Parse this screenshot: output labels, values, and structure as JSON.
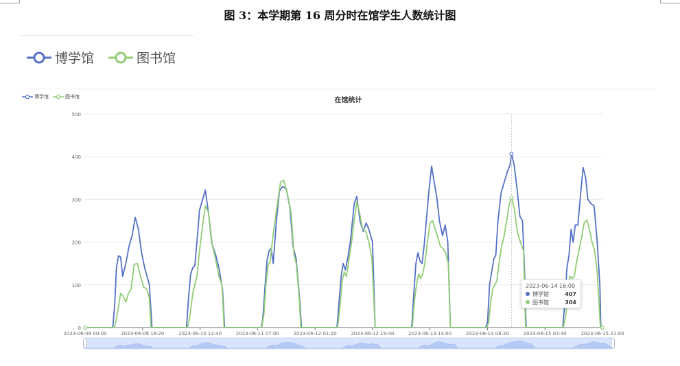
{
  "figure_title": "图 3：本学期第 16 周分时在馆学生人数统计图",
  "legend_big": [
    {
      "label": "博学馆",
      "color": "#5470c6"
    },
    {
      "label": "图书馆",
      "color": "#91cc75"
    }
  ],
  "chart_data": {
    "type": "line",
    "title": "在馆统计",
    "xlabel": "",
    "ylabel": "",
    "ylim": [
      0,
      500
    ],
    "yticks": [
      0,
      100,
      200,
      300,
      400,
      500
    ],
    "xlim": [
      "2023-06-09 00:00",
      "2023-06-15 21:00"
    ],
    "xticks": [
      "2023-06-09 00:00",
      "2023-06-09 18:20",
      "2023-06-10 12:40",
      "2023-06-11 07:00",
      "2023-06-12 01:20",
      "2023-06-12 19:40",
      "2023-06-13 14:00",
      "2023-06-14 08:20",
      "2023-06-15 02:40",
      "2023-06-15 21:00"
    ],
    "grid": true,
    "legend_position": "top-left",
    "series": [
      {
        "name": "博学馆",
        "color": "#5470c6",
        "points": [
          [
            "2023-06-09 00:00",
            0
          ],
          [
            "2023-06-09 08:50",
            0
          ],
          [
            "2023-06-09 09:30",
            60
          ],
          [
            "2023-06-09 10:00",
            140
          ],
          [
            "2023-06-09 10:40",
            168
          ],
          [
            "2023-06-09 11:20",
            165
          ],
          [
            "2023-06-09 12:00",
            120
          ],
          [
            "2023-06-09 13:00",
            150
          ],
          [
            "2023-06-09 14:00",
            190
          ],
          [
            "2023-06-09 15:00",
            215
          ],
          [
            "2023-06-09 16:00",
            258
          ],
          [
            "2023-06-09 17:00",
            230
          ],
          [
            "2023-06-09 18:00",
            175
          ],
          [
            "2023-06-09 19:00",
            140
          ],
          [
            "2023-06-09 20:30",
            100
          ],
          [
            "2023-06-09 21:20",
            0
          ],
          [
            "2023-06-10 08:20",
            0
          ],
          [
            "2023-06-10 09:00",
            70
          ],
          [
            "2023-06-10 09:40",
            125
          ],
          [
            "2023-06-10 10:20",
            140
          ],
          [
            "2023-06-10 11:00",
            145
          ],
          [
            "2023-06-10 11:40",
            200
          ],
          [
            "2023-06-10 12:30",
            275
          ],
          [
            "2023-06-10 13:30",
            300
          ],
          [
            "2023-06-10 14:20",
            322
          ],
          [
            "2023-06-10 15:20",
            270
          ],
          [
            "2023-06-10 16:30",
            195
          ],
          [
            "2023-06-10 17:40",
            170
          ],
          [
            "2023-06-10 18:40",
            140
          ],
          [
            "2023-06-10 19:50",
            90
          ],
          [
            "2023-06-10 20:30",
            0
          ],
          [
            "2023-06-11 08:10",
            0
          ],
          [
            "2023-06-11 08:40",
            20
          ],
          [
            "2023-06-11 09:20",
            90
          ],
          [
            "2023-06-11 10:00",
            155
          ],
          [
            "2023-06-11 10:40",
            180
          ],
          [
            "2023-06-11 11:20",
            185
          ],
          [
            "2023-06-11 12:00",
            150
          ],
          [
            "2023-06-11 13:00",
            250
          ],
          [
            "2023-06-11 14:00",
            320
          ],
          [
            "2023-06-11 15:00",
            330
          ],
          [
            "2023-06-11 16:10",
            325
          ],
          [
            "2023-06-11 17:20",
            280
          ],
          [
            "2023-06-11 18:20",
            190
          ],
          [
            "2023-06-11 19:20",
            160
          ],
          [
            "2023-06-11 20:30",
            60
          ],
          [
            "2023-06-11 21:00",
            0
          ],
          [
            "2023-06-12 08:20",
            0
          ],
          [
            "2023-06-12 09:00",
            60
          ],
          [
            "2023-06-12 09:40",
            120
          ],
          [
            "2023-06-12 10:20",
            150
          ],
          [
            "2023-06-12 11:00",
            135
          ],
          [
            "2023-06-12 11:50",
            165
          ],
          [
            "2023-06-12 12:40",
            205
          ],
          [
            "2023-06-12 13:50",
            290
          ],
          [
            "2023-06-12 14:40",
            307
          ],
          [
            "2023-06-12 15:40",
            250
          ],
          [
            "2023-06-12 16:40",
            225
          ],
          [
            "2023-06-12 17:40",
            245
          ],
          [
            "2023-06-12 18:30",
            230
          ],
          [
            "2023-06-12 19:40",
            200
          ],
          [
            "2023-06-12 20:30",
            0
          ],
          [
            "2023-06-13 08:10",
            0
          ],
          [
            "2023-06-13 08:50",
            80
          ],
          [
            "2023-06-13 09:30",
            150
          ],
          [
            "2023-06-13 10:10",
            175
          ],
          [
            "2023-06-13 10:50",
            155
          ],
          [
            "2023-06-13 11:30",
            150
          ],
          [
            "2023-06-13 12:10",
            195
          ],
          [
            "2023-06-13 12:50",
            250
          ],
          [
            "2023-06-13 13:40",
            320
          ],
          [
            "2023-06-13 14:30",
            378
          ],
          [
            "2023-06-13 15:20",
            340
          ],
          [
            "2023-06-13 16:10",
            305
          ],
          [
            "2023-06-13 17:00",
            250
          ],
          [
            "2023-06-13 18:00",
            215
          ],
          [
            "2023-06-13 18:50",
            240
          ],
          [
            "2023-06-13 19:40",
            200
          ],
          [
            "2023-06-13 20:30",
            0
          ],
          [
            "2023-06-14 07:40",
            0
          ],
          [
            "2023-06-14 08:20",
            10
          ],
          [
            "2023-06-14 09:00",
            100
          ],
          [
            "2023-06-14 09:40",
            130
          ],
          [
            "2023-06-14 10:20",
            160
          ],
          [
            "2023-06-14 11:00",
            170
          ],
          [
            "2023-06-14 11:40",
            250
          ],
          [
            "2023-06-14 12:40",
            315
          ],
          [
            "2023-06-14 13:40",
            340
          ],
          [
            "2023-06-14 14:40",
            365
          ],
          [
            "2023-06-14 15:30",
            380
          ],
          [
            "2023-06-14 16:00",
            407
          ],
          [
            "2023-06-14 16:50",
            380
          ],
          [
            "2023-06-14 17:50",
            320
          ],
          [
            "2023-06-14 18:40",
            260
          ],
          [
            "2023-06-14 19:30",
            250
          ],
          [
            "2023-06-14 20:10",
            130
          ],
          [
            "2023-06-14 20:40",
            0
          ],
          [
            "2023-06-15 08:20",
            0
          ],
          [
            "2023-06-15 09:00",
            60
          ],
          [
            "2023-06-15 09:40",
            140
          ],
          [
            "2023-06-15 10:20",
            170
          ],
          [
            "2023-06-15 11:00",
            230
          ],
          [
            "2023-06-15 11:40",
            200
          ],
          [
            "2023-06-15 12:20",
            240
          ],
          [
            "2023-06-15 13:10",
            240
          ],
          [
            "2023-06-15 14:00",
            310
          ],
          [
            "2023-06-15 14:50",
            375
          ],
          [
            "2023-06-15 15:40",
            350
          ],
          [
            "2023-06-15 16:20",
            300
          ],
          [
            "2023-06-15 17:20",
            290
          ],
          [
            "2023-06-15 18:20",
            285
          ],
          [
            "2023-06-15 19:20",
            200
          ],
          [
            "2023-06-15 20:10",
            100
          ],
          [
            "2023-06-15 20:30",
            0
          ],
          [
            "2023-06-15 21:00",
            0
          ]
        ]
      },
      {
        "name": "图书馆",
        "color": "#91cc75",
        "points": [
          [
            "2023-06-09 00:00",
            0
          ],
          [
            "2023-06-09 09:20",
            0
          ],
          [
            "2023-06-09 10:00",
            20
          ],
          [
            "2023-06-09 10:40",
            50
          ],
          [
            "2023-06-09 11:20",
            80
          ],
          [
            "2023-06-09 12:00",
            75
          ],
          [
            "2023-06-09 13:00",
            60
          ],
          [
            "2023-06-09 13:50",
            80
          ],
          [
            "2023-06-09 14:40",
            90
          ],
          [
            "2023-06-09 15:40",
            148
          ],
          [
            "2023-06-09 16:40",
            150
          ],
          [
            "2023-06-09 17:40",
            120
          ],
          [
            "2023-06-09 18:40",
            95
          ],
          [
            "2023-06-09 19:40",
            90
          ],
          [
            "2023-06-09 20:30",
            70
          ],
          [
            "2023-06-09 21:00",
            0
          ],
          [
            "2023-06-10 08:40",
            0
          ],
          [
            "2023-06-10 09:30",
            30
          ],
          [
            "2023-06-10 10:20",
            80
          ],
          [
            "2023-06-10 11:00",
            100
          ],
          [
            "2023-06-10 11:40",
            120
          ],
          [
            "2023-06-10 12:30",
            180
          ],
          [
            "2023-06-10 13:30",
            240
          ],
          [
            "2023-06-10 14:20",
            285
          ],
          [
            "2023-06-10 15:20",
            270
          ],
          [
            "2023-06-10 16:20",
            200
          ],
          [
            "2023-06-10 17:20",
            170
          ],
          [
            "2023-06-10 18:40",
            120
          ],
          [
            "2023-06-10 19:40",
            100
          ],
          [
            "2023-06-10 20:20",
            0
          ],
          [
            "2023-06-11 08:20",
            0
          ],
          [
            "2023-06-11 09:00",
            30
          ],
          [
            "2023-06-11 09:40",
            100
          ],
          [
            "2023-06-11 10:20",
            145
          ],
          [
            "2023-06-11 11:00",
            155
          ],
          [
            "2023-06-11 12:00",
            220
          ],
          [
            "2023-06-11 13:20",
            290
          ],
          [
            "2023-06-11 14:20",
            340
          ],
          [
            "2023-06-11 15:20",
            345
          ],
          [
            "2023-06-11 16:20",
            320
          ],
          [
            "2023-06-11 17:40",
            270
          ],
          [
            "2023-06-11 18:40",
            170
          ],
          [
            "2023-06-11 19:20",
            150
          ],
          [
            "2023-06-11 20:10",
            80
          ],
          [
            "2023-06-11 20:50",
            0
          ],
          [
            "2023-06-12 08:30",
            0
          ],
          [
            "2023-06-12 09:10",
            40
          ],
          [
            "2023-06-12 10:00",
            110
          ],
          [
            "2023-06-12 10:40",
            130
          ],
          [
            "2023-06-12 11:20",
            120
          ],
          [
            "2023-06-12 12:10",
            160
          ],
          [
            "2023-06-12 13:00",
            200
          ],
          [
            "2023-06-12 13:50",
            250
          ],
          [
            "2023-06-12 14:40",
            295
          ],
          [
            "2023-06-12 15:30",
            270
          ],
          [
            "2023-06-12 16:30",
            230
          ],
          [
            "2023-06-12 17:30",
            225
          ],
          [
            "2023-06-12 18:30",
            200
          ],
          [
            "2023-06-12 19:30",
            160
          ],
          [
            "2023-06-12 20:30",
            0
          ],
          [
            "2023-06-13 08:20",
            0
          ],
          [
            "2023-06-13 09:00",
            60
          ],
          [
            "2023-06-13 09:40",
            100
          ],
          [
            "2023-06-13 10:20",
            125
          ],
          [
            "2023-06-13 11:00",
            115
          ],
          [
            "2023-06-13 11:40",
            125
          ],
          [
            "2023-06-13 12:20",
            150
          ],
          [
            "2023-06-13 13:10",
            200
          ],
          [
            "2023-06-13 14:00",
            245
          ],
          [
            "2023-06-13 14:50",
            250
          ],
          [
            "2023-06-13 15:40",
            230
          ],
          [
            "2023-06-13 16:30",
            210
          ],
          [
            "2023-06-13 17:20",
            190
          ],
          [
            "2023-06-13 18:10",
            185
          ],
          [
            "2023-06-13 19:00",
            175
          ],
          [
            "2023-06-13 19:50",
            150
          ],
          [
            "2023-06-13 20:30",
            0
          ],
          [
            "2023-06-14 08:00",
            0
          ],
          [
            "2023-06-14 08:40",
            10
          ],
          [
            "2023-06-14 09:20",
            60
          ],
          [
            "2023-06-14 10:00",
            90
          ],
          [
            "2023-06-14 10:40",
            100
          ],
          [
            "2023-06-14 11:20",
            110
          ],
          [
            "2023-06-14 12:00",
            150
          ],
          [
            "2023-06-14 12:50",
            190
          ],
          [
            "2023-06-14 13:40",
            215
          ],
          [
            "2023-06-14 14:40",
            260
          ],
          [
            "2023-06-14 15:20",
            290
          ],
          [
            "2023-06-14 16:00",
            304
          ],
          [
            "2023-06-14 16:50",
            280
          ],
          [
            "2023-06-14 17:50",
            225
          ],
          [
            "2023-06-14 18:50",
            200
          ],
          [
            "2023-06-14 19:50",
            180
          ],
          [
            "2023-06-14 20:30",
            0
          ],
          [
            "2023-06-15 08:30",
            0
          ],
          [
            "2023-06-15 09:20",
            30
          ],
          [
            "2023-06-15 10:00",
            90
          ],
          [
            "2023-06-15 10:40",
            120
          ],
          [
            "2023-06-15 11:20",
            115
          ],
          [
            "2023-06-15 12:00",
            120
          ],
          [
            "2023-06-15 12:40",
            150
          ],
          [
            "2023-06-15 13:30",
            180
          ],
          [
            "2023-06-15 14:20",
            210
          ],
          [
            "2023-06-15 15:10",
            245
          ],
          [
            "2023-06-15 16:00",
            252
          ],
          [
            "2023-06-15 16:50",
            230
          ],
          [
            "2023-06-15 17:40",
            200
          ],
          [
            "2023-06-15 18:30",
            180
          ],
          [
            "2023-06-15 19:20",
            130
          ],
          [
            "2023-06-15 20:20",
            0
          ],
          [
            "2023-06-15 21:00",
            0
          ]
        ]
      }
    ],
    "tooltip": {
      "time": "2023-06-14 16:00",
      "rows": [
        {
          "name": "博学馆",
          "value": "407",
          "color": "#5470c6"
        },
        {
          "name": "图书馆",
          "value": "304",
          "color": "#91cc75"
        }
      ]
    },
    "zoom_slider": {
      "range_percent": [
        0,
        100
      ]
    }
  }
}
